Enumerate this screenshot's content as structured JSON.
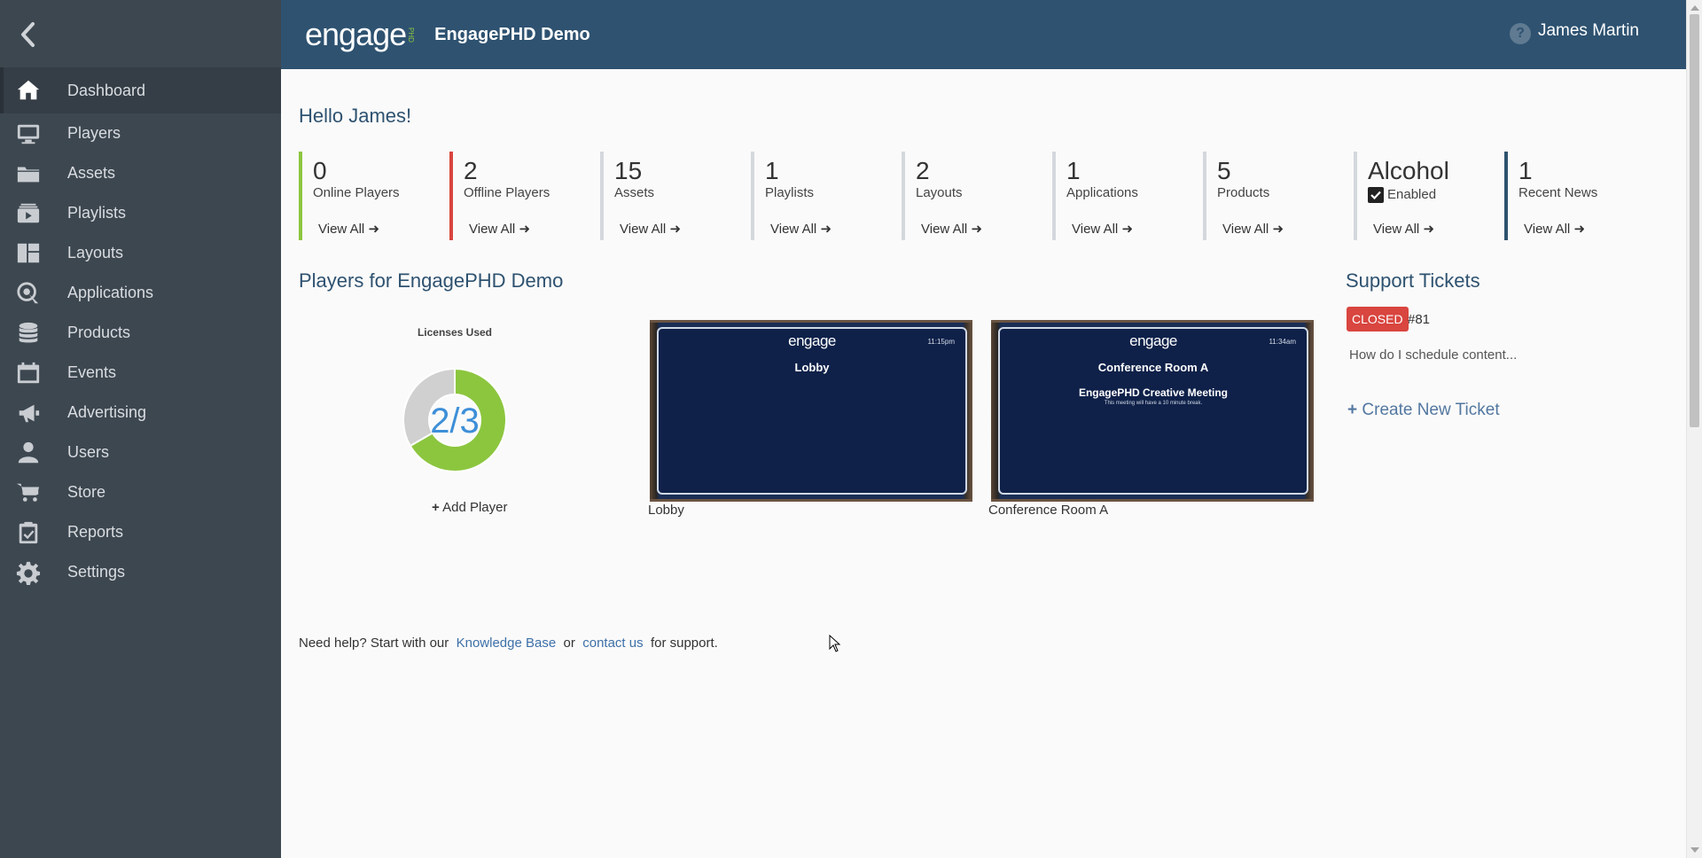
{
  "sidebar": {
    "items": [
      {
        "label": "Dashboard",
        "icon": "home-icon",
        "active": true
      },
      {
        "label": "Players",
        "icon": "monitor-icon"
      },
      {
        "label": "Assets",
        "icon": "folder-icon"
      },
      {
        "label": "Playlists",
        "icon": "playlist-icon"
      },
      {
        "label": "Layouts",
        "icon": "layout-icon"
      },
      {
        "label": "Applications",
        "icon": "applications-icon"
      },
      {
        "label": "Products",
        "icon": "database-icon"
      },
      {
        "label": "Events",
        "icon": "calendar-icon"
      },
      {
        "label": "Advertising",
        "icon": "megaphone-icon"
      },
      {
        "label": "Users",
        "icon": "user-icon"
      },
      {
        "label": "Store",
        "icon": "cart-icon"
      },
      {
        "label": "Reports",
        "icon": "clipboard-icon"
      },
      {
        "label": "Settings",
        "icon": "gear-icon"
      }
    ]
  },
  "header": {
    "logo_text": "engage",
    "logo_sub": "PHD",
    "org_name": "EngagePHD Demo",
    "help": "?",
    "user": "James Martin"
  },
  "main": {
    "greeting": "Hello James!",
    "stats": [
      {
        "num": "0",
        "label": "Online Players",
        "color": "#8cc63f"
      },
      {
        "num": "2",
        "label": "Offline Players",
        "color": "#d9453f"
      },
      {
        "num": "15",
        "label": "Assets",
        "color": "#d4d8dd"
      },
      {
        "num": "1",
        "label": "Playlists",
        "color": "#d4d8dd"
      },
      {
        "num": "2",
        "label": "Layouts",
        "color": "#d4d8dd"
      },
      {
        "num": "1",
        "label": "Applications",
        "color": "#d4d8dd"
      },
      {
        "num": "5",
        "label": "Products",
        "color": "#d4d8dd"
      },
      {
        "num": "Alcohol",
        "label": "Enabled",
        "color": "#d4d8dd"
      },
      {
        "num": "1",
        "label": "Recent News",
        "color": "#2e5270"
      }
    ],
    "view_all": "View All",
    "players_title": "Players for EngagePHD Demo",
    "licenses": {
      "title": "Licenses Used",
      "used": 2,
      "total": 3,
      "text": "2/3"
    },
    "add_player": "Add Player",
    "screens": [
      {
        "label": "Lobby",
        "logo": "engage",
        "time": "11:15pm",
        "title": "Lobby",
        "sub": "",
        "note": ""
      },
      {
        "label": "Conference Room A",
        "logo": "engage",
        "time": "11:34am",
        "title": "Conference Room A",
        "sub": "EngagePHD Creative Meeting",
        "note": "This meeting will have a 10 minute break."
      }
    ],
    "support": {
      "title": "Support Tickets",
      "status": "CLOSED",
      "number": "#81",
      "subject": "How do I schedule content...",
      "create": "Create New Ticket"
    },
    "help": {
      "prefix": "Need help? Start with our",
      "kb": "Knowledge Base",
      "or": "or",
      "contact": "contact us",
      "suffix": "for support."
    }
  },
  "colors": {
    "sidebar_bg": "#3d4750",
    "topbar_bg": "#2e5270",
    "donut_used": "#8cc63f",
    "donut_free": "#d0d0d0",
    "donut_text": "#3d8fd8"
  }
}
